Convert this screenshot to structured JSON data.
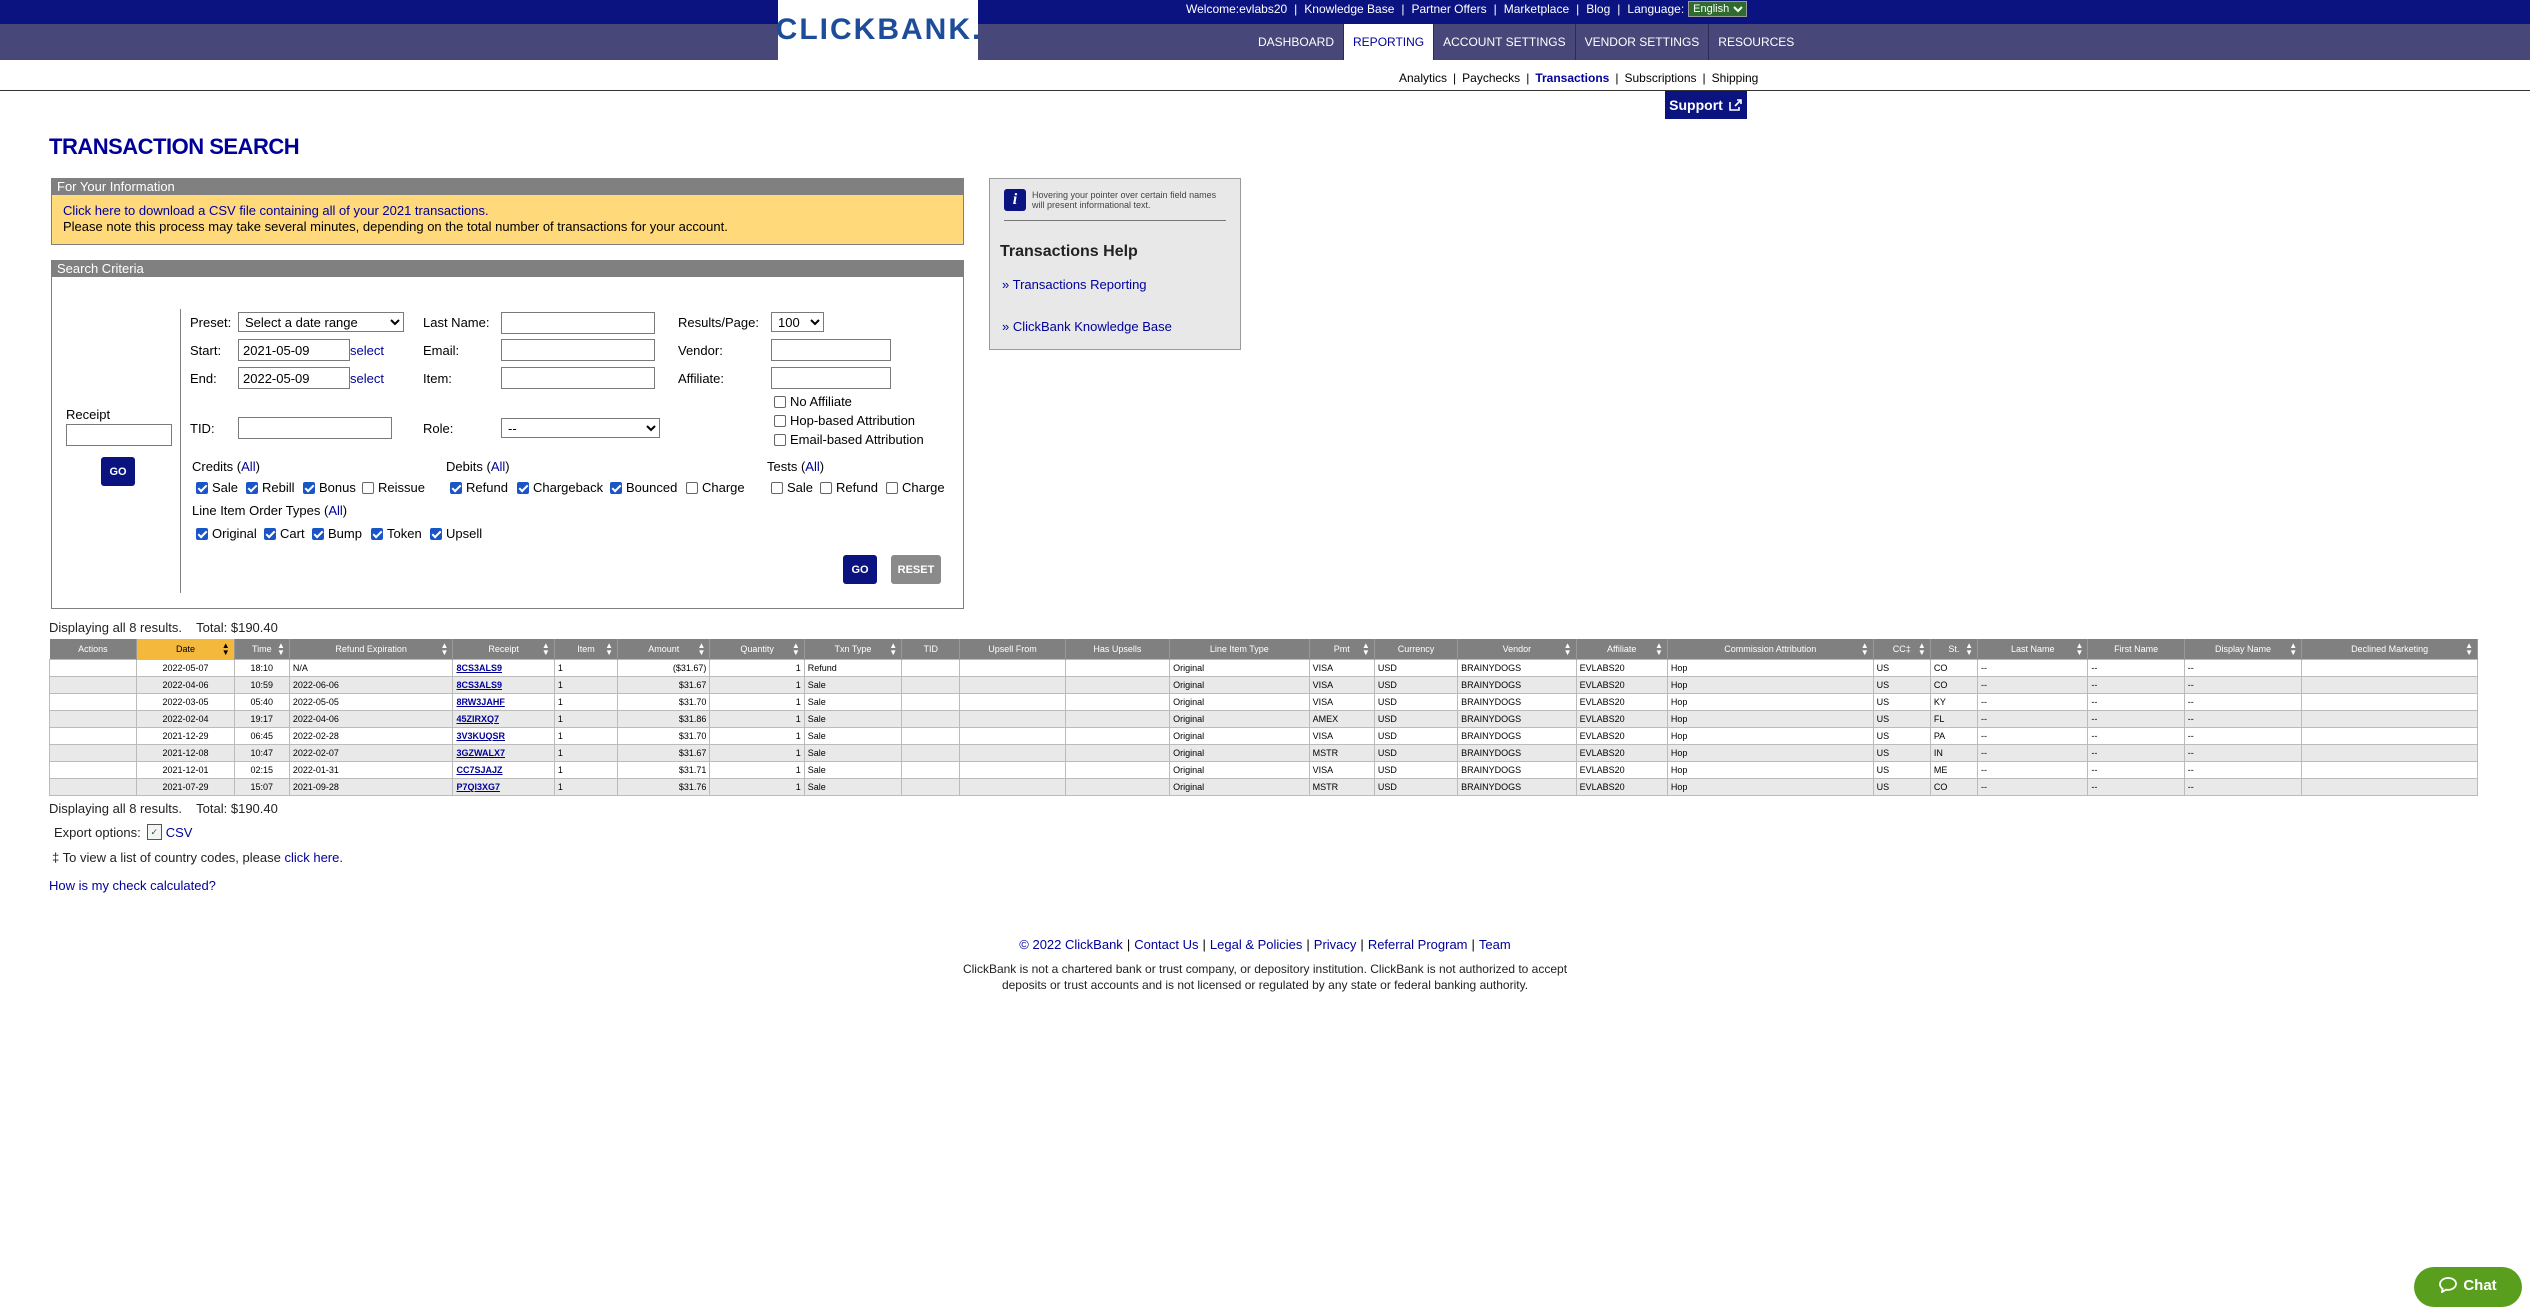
{
  "header": {
    "welcome": "Welcome:evlabs20",
    "top_links": [
      "Knowledge Base",
      "Partner Offers",
      "Marketplace",
      "Blog"
    ],
    "language_label": "Language:",
    "language_value": "English",
    "logo": "CLICKBANK",
    "main_nav": [
      "DASHBOARD",
      "REPORTING",
      "ACCOUNT SETTINGS",
      "VENDOR SETTINGS",
      "RESOURCES"
    ],
    "sub_nav": [
      "Analytics",
      "Paychecks",
      "Transactions",
      "Subscriptions",
      "Shipping"
    ],
    "support_label": "Support"
  },
  "page_title": "TRANSACTION SEARCH",
  "fyi": {
    "heading": "For Your Information",
    "link_text": "Click here to download a CSV file containing all of your 2021 transactions.",
    "note": "Please note this process may take several minutes, depending on the total number of transactions for your account."
  },
  "criteria": {
    "heading": "Search Criteria",
    "receipt_label": "Receipt",
    "go_label": "GO",
    "reset_label": "RESET",
    "preset_label": "Preset:",
    "preset_value": "Select a date range",
    "start_label": "Start:",
    "start_value": "2021-05-09",
    "end_label": "End:",
    "end_value": "2022-05-09",
    "select_label": "select",
    "tid_label": "TID:",
    "last_name_label": "Last Name:",
    "email_label": "Email:",
    "item_label": "Item:",
    "role_label": "Role:",
    "role_value": "--",
    "results_page_label": "Results/Page:",
    "results_page_value": "100",
    "vendor_label": "Vendor:",
    "affiliate_label": "Affiliate:",
    "no_affiliate": "No Affiliate",
    "hop_attr": "Hop-based Attribution",
    "email_attr": "Email-based Attribution",
    "credits_label": "Credits",
    "debits_label": "Debits",
    "tests_label": "Tests",
    "line_item_label": "Line Item Order Types",
    "all_label": "All",
    "credits": [
      "Sale",
      "Rebill",
      "Bonus",
      "Reissue"
    ],
    "debits": [
      "Refund",
      "Chargeback",
      "Bounced",
      "Charge"
    ],
    "tests": [
      "Sale",
      "Refund",
      "Charge"
    ],
    "line_items": [
      "Original",
      "Cart",
      "Bump",
      "Token",
      "Upsell"
    ]
  },
  "help": {
    "note": "Hovering your pointer over certain field names will present informational text.",
    "title": "Transactions Help",
    "links": [
      "Transactions Reporting",
      "ClickBank Knowledge Base"
    ]
  },
  "results": {
    "summary": "Displaying all 8 results.",
    "total": "Total: $190.40",
    "columns": [
      "Actions",
      "Date",
      "Time",
      "Refund Expiration",
      "Receipt",
      "Item",
      "Amount",
      "Quantity",
      "Txn Type",
      "TID",
      "Upsell From",
      "Has Upsells",
      "Line Item Type",
      "Pmt",
      "Currency",
      "Vendor",
      "Affiliate",
      "Commission Attribution",
      "CC‡",
      "St.",
      "Last Name",
      "First Name",
      "Display Name",
      "Declined Marketing"
    ],
    "rows": [
      [
        "",
        "2022-05-07",
        "18:10",
        "N/A",
        "8CS3ALS9",
        "1",
        "($31.67)",
        "1",
        "Refund",
        "",
        "",
        "",
        "Original",
        "VISA",
        "USD",
        "BRAINYDOGS",
        "EVLABS20",
        "Hop",
        "US",
        "CO",
        "--",
        "--",
        "--",
        ""
      ],
      [
        "",
        "2022-04-06",
        "10:59",
        "2022-06-06",
        "8CS3ALS9",
        "1",
        "$31.67",
        "1",
        "Sale",
        "",
        "",
        "",
        "Original",
        "VISA",
        "USD",
        "BRAINYDOGS",
        "EVLABS20",
        "Hop",
        "US",
        "CO",
        "--",
        "--",
        "--",
        ""
      ],
      [
        "",
        "2022-03-05",
        "05:40",
        "2022-05-05",
        "8RW3JAHF",
        "1",
        "$31.70",
        "1",
        "Sale",
        "",
        "",
        "",
        "Original",
        "VISA",
        "USD",
        "BRAINYDOGS",
        "EVLABS20",
        "Hop",
        "US",
        "KY",
        "--",
        "--",
        "--",
        ""
      ],
      [
        "",
        "2022-02-04",
        "19:17",
        "2022-04-06",
        "45ZIRXQ7",
        "1",
        "$31.86",
        "1",
        "Sale",
        "",
        "",
        "",
        "Original",
        "AMEX",
        "USD",
        "BRAINYDOGS",
        "EVLABS20",
        "Hop",
        "US",
        "FL",
        "--",
        "--",
        "--",
        ""
      ],
      [
        "",
        "2021-12-29",
        "06:45",
        "2022-02-28",
        "3V3KUQSR",
        "1",
        "$31.70",
        "1",
        "Sale",
        "",
        "",
        "",
        "Original",
        "VISA",
        "USD",
        "BRAINYDOGS",
        "EVLABS20",
        "Hop",
        "US",
        "PA",
        "--",
        "--",
        "--",
        ""
      ],
      [
        "",
        "2021-12-08",
        "10:47",
        "2022-02-07",
        "3GZWALX7",
        "1",
        "$31.67",
        "1",
        "Sale",
        "",
        "",
        "",
        "Original",
        "MSTR",
        "USD",
        "BRAINYDOGS",
        "EVLABS20",
        "Hop",
        "US",
        "IN",
        "--",
        "--",
        "--",
        ""
      ],
      [
        "",
        "2021-12-01",
        "02:15",
        "2022-01-31",
        "CC7SJAJZ",
        "1",
        "$31.71",
        "1",
        "Sale",
        "",
        "",
        "",
        "Original",
        "VISA",
        "USD",
        "BRAINYDOGS",
        "EVLABS20",
        "Hop",
        "US",
        "ME",
        "--",
        "--",
        "--",
        ""
      ],
      [
        "",
        "2021-07-29",
        "15:07",
        "2021-09-28",
        "P7QI3XG7",
        "1",
        "$31.76",
        "1",
        "Sale",
        "",
        "",
        "",
        "Original",
        "MSTR",
        "USD",
        "BRAINYDOGS",
        "EVLABS20",
        "Hop",
        "US",
        "CO",
        "--",
        "--",
        "--",
        ""
      ]
    ],
    "export_label": "Export options:",
    "export_csv": "CSV",
    "country_note_prefix": "‡ To view a list of country codes, please",
    "country_note_link": "click here",
    "check_link": "How is my check calculated?"
  },
  "footer": {
    "links": [
      "© 2022 ClickBank",
      "Contact Us",
      "Legal & Policies",
      "Privacy",
      "Referral Program",
      "Team"
    ],
    "disclaimer": "ClickBank is not a chartered bank or trust company, or depository institution. ClickBank is not authorized to accept deposits or trust accounts and is not licensed or regulated by any state or federal banking authority."
  },
  "chat_label": "Chat"
}
